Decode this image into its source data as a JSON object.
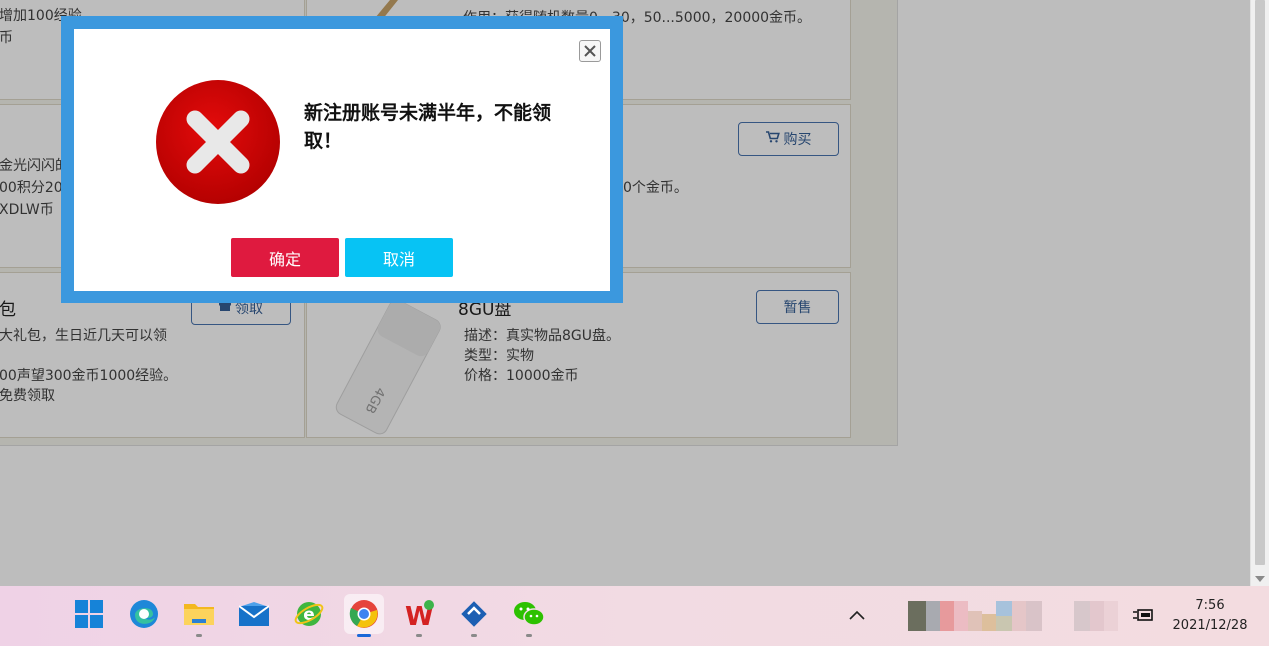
{
  "background_page": {
    "cards": [
      {
        "lines": [
          "增加100经验",
          "币"
        ]
      },
      {
        "lines": [
          "作用：获得随机数量0、30，50...5000，20000金币。"
        ]
      },
      {
        "lines": [
          "金光闪闪的",
          "00积分20",
          "XDLW币"
        ]
      },
      {
        "lines": [
          "0个金币。"
        ],
        "button": "购买"
      },
      {
        "title": "包",
        "lines": [
          "大礼包，生日近几天可以领",
          "00声望300金币1000经验。",
          "免费领取"
        ],
        "button": "领取"
      },
      {
        "title": "8GU盘",
        "lines": [
          "描述：真实物品8GU盘。",
          "类型：实物",
          "价格：10000金币"
        ],
        "button": "暂售"
      }
    ]
  },
  "modal": {
    "message": "新注册账号未满半年，不能领取！",
    "confirm_label": "确定",
    "cancel_label": "取消",
    "close_icon": "close-icon",
    "status_icon": "error-x-icon",
    "colors": {
      "frame": "#3b98de",
      "confirm": "#df1a3f",
      "cancel": "#07c3f4",
      "error": "#c90000"
    }
  },
  "taskbar": {
    "apps": [
      {
        "name": "start-menu",
        "icon": "windows-logo-icon"
      },
      {
        "name": "edge",
        "icon": "edge-browser-icon"
      },
      {
        "name": "file-explorer",
        "icon": "folder-icon"
      },
      {
        "name": "mail",
        "icon": "mail-icon"
      },
      {
        "name": "ie-browser",
        "icon": "ie-browser-icon"
      },
      {
        "name": "chrome",
        "icon": "chrome-browser-icon",
        "active": true
      },
      {
        "name": "wps",
        "icon": "wps-office-icon"
      },
      {
        "name": "app-blue",
        "icon": "blue-diamond-app-icon"
      },
      {
        "name": "wechat",
        "icon": "wechat-icon"
      }
    ],
    "time": "7:56",
    "date": "2021/12/28"
  }
}
